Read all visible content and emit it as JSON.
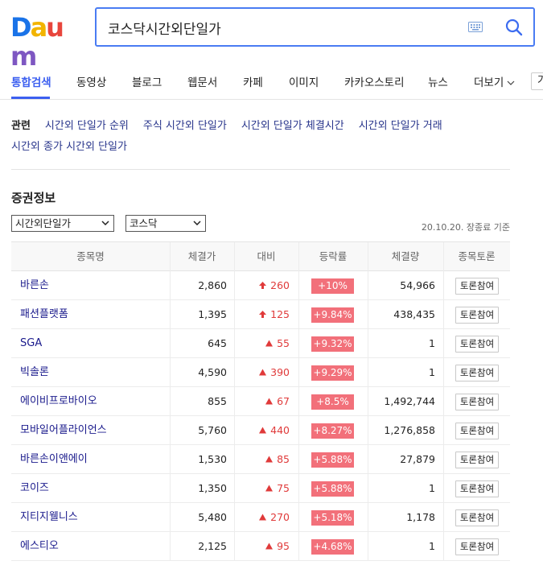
{
  "header": {
    "logo": {
      "letters": [
        "D",
        "a",
        "u",
        "m"
      ],
      "colors": [
        "#1a73e8",
        "#f2b400",
        "#e8453c",
        "#7e57c2"
      ]
    },
    "search": {
      "value": "코스닥시간외단일가"
    },
    "colors": {
      "accent": "#4a7cf3"
    }
  },
  "nav": {
    "items": [
      {
        "label": "통합검색",
        "active": true
      },
      {
        "label": "동영상"
      },
      {
        "label": "블로그"
      },
      {
        "label": "웹문서"
      },
      {
        "label": "카페"
      },
      {
        "label": "이미지"
      },
      {
        "label": "카카오스토리"
      },
      {
        "label": "뉴스"
      },
      {
        "label": "더보기"
      }
    ],
    "extra_label": "가"
  },
  "related": {
    "label": "관련",
    "links": [
      "시간외 단일가 순위",
      "주식 시간외 단일가",
      "시간외 단일가 체결시간",
      "시간외 단일가 거래",
      "시간외 종가 시간외 단일가"
    ]
  },
  "stock": {
    "title": "증권정보",
    "select_type": "시간외단일가",
    "select_market": "코스닥",
    "base_date": "20.10.20. 장종료 기준",
    "headers": [
      "종목명",
      "체결가",
      "대비",
      "등락률",
      "체결량",
      "종목토론"
    ],
    "button_label": "토론참여",
    "colors": {
      "up": "#e03a3a",
      "rate_bg": "#f2707a"
    },
    "rows": [
      {
        "name": "바른손",
        "price": "2,860",
        "diff": "260",
        "icon": "upper-limit-arrow-icon",
        "rate": "+10%",
        "volume": "54,966"
      },
      {
        "name": "패션플랫폼",
        "price": "1,395",
        "diff": "125",
        "icon": "upper-limit-arrow-icon",
        "rate": "+9.84%",
        "volume": "438,435"
      },
      {
        "name": "SGA",
        "price": "645",
        "diff": "55",
        "icon": "up-triangle-icon",
        "rate": "+9.32%",
        "volume": "1"
      },
      {
        "name": "빅솔론",
        "price": "4,590",
        "diff": "390",
        "icon": "up-triangle-icon",
        "rate": "+9.29%",
        "volume": "1"
      },
      {
        "name": "에이비프로바이오",
        "price": "855",
        "diff": "67",
        "icon": "up-triangle-icon",
        "rate": "+8.5%",
        "volume": "1,492,744"
      },
      {
        "name": "모바일어플라이언스",
        "price": "5,760",
        "diff": "440",
        "icon": "up-triangle-icon",
        "rate": "+8.27%",
        "volume": "1,276,858"
      },
      {
        "name": "바른손이앤에이",
        "price": "1,530",
        "diff": "85",
        "icon": "up-triangle-icon",
        "rate": "+5.88%",
        "volume": "27,879"
      },
      {
        "name": "코이즈",
        "price": "1,350",
        "diff": "75",
        "icon": "up-triangle-icon",
        "rate": "+5.88%",
        "volume": "1"
      },
      {
        "name": "지티지웰니스",
        "price": "5,480",
        "diff": "270",
        "icon": "up-triangle-icon",
        "rate": "+5.18%",
        "volume": "1,178"
      },
      {
        "name": "에스티오",
        "price": "2,125",
        "diff": "95",
        "icon": "up-triangle-icon",
        "rate": "+4.68%",
        "volume": "1"
      }
    ]
  }
}
